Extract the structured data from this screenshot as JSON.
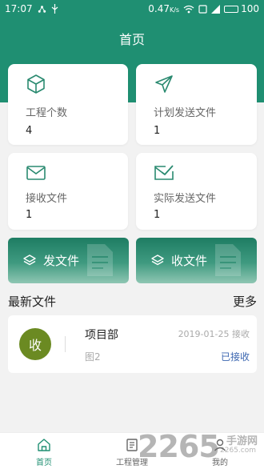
{
  "status_bar": {
    "time": "17:07",
    "speed": "0.47",
    "speed_unit": "K/s",
    "battery": "100"
  },
  "header": {
    "title": "首页"
  },
  "stats": [
    {
      "label": "工程个数",
      "value": "4",
      "icon": "cube-icon"
    },
    {
      "label": "计划发送文件",
      "value": "1",
      "icon": "send-icon"
    },
    {
      "label": "接收文件",
      "value": "1",
      "icon": "mail-icon"
    },
    {
      "label": "实际发送文件",
      "value": "1",
      "icon": "mail-check-icon"
    }
  ],
  "actions": {
    "send": "发文件",
    "receive": "收文件"
  },
  "latest": {
    "title": "最新文件",
    "more": "更多",
    "items": [
      {
        "badge": "收",
        "name": "项目部",
        "sub": "图2",
        "date": "2019-01-25 接收",
        "status": "已接收"
      }
    ]
  },
  "tabs": [
    {
      "label": "首页",
      "icon": "home-icon"
    },
    {
      "label": "工程管理",
      "icon": "project-list-icon"
    },
    {
      "label": "我的",
      "icon": "user-icon"
    }
  ],
  "watermark": {
    "number": "2265",
    "text": "手游网",
    "domain": "2265.com"
  },
  "colors": {
    "primary": "#1f8f72",
    "badge": "#6b8a22",
    "status": "#3b66b0"
  }
}
